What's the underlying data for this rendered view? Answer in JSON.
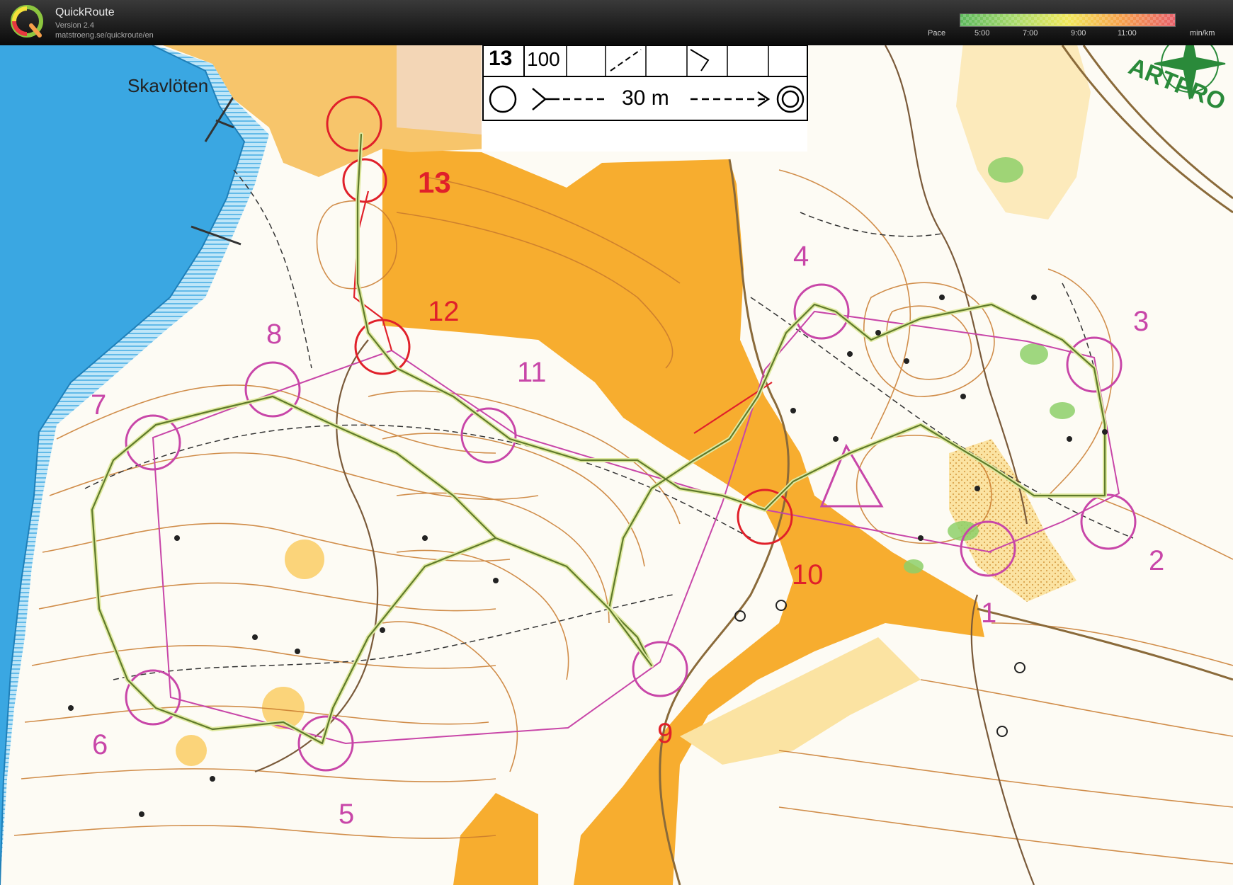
{
  "app": {
    "title": "QuickRoute",
    "version": "Version 2.4",
    "url": "matstroeng.se/quickroute/en"
  },
  "pace_legend": {
    "label": "Pace",
    "ticks": [
      "5:00",
      "7:00",
      "9:00",
      "11:00"
    ],
    "unit": "min/km",
    "colors": [
      "#5cb85c",
      "#a6d96a",
      "#f1e85a",
      "#f6a04a",
      "#e8606a"
    ]
  },
  "map": {
    "place_name": "Skavlöten",
    "control_box": {
      "row1": [
        "13",
        "100"
      ],
      "distance": "30 m"
    },
    "corner_text": "ARTPRO",
    "controls": [
      "1",
      "2",
      "3",
      "4",
      "5",
      "6",
      "7",
      "8",
      "9",
      "10",
      "11",
      "12",
      "13"
    ],
    "colors": {
      "water": "#3aa7e2",
      "open_land": "#f7ad2f",
      "rough_open": "#fbe3a2",
      "contour": "#c97a2d",
      "course": "#c846a8",
      "route": "#7c8f3c",
      "leg_red": "#e0202a"
    }
  }
}
